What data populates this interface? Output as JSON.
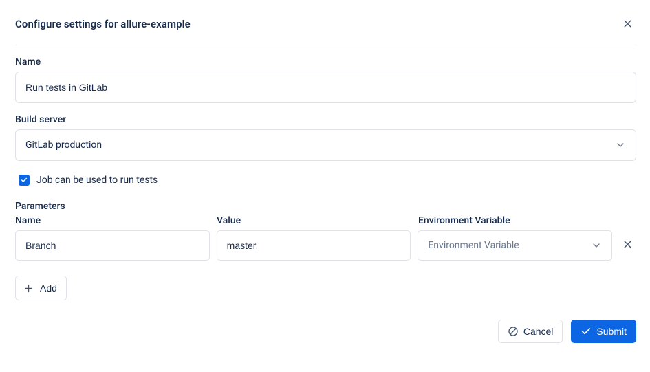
{
  "header": {
    "title": "Configure settings for allure-example"
  },
  "name": {
    "label": "Name",
    "value": "Run tests in GitLab"
  },
  "buildServer": {
    "label": "Build server",
    "value": "GitLab production"
  },
  "runTests": {
    "checked": true,
    "label": "Job can be used to run tests"
  },
  "parameters": {
    "sectionLabel": "Parameters",
    "columns": {
      "name": "Name",
      "value": "Value",
      "env": "Environment Variable"
    },
    "rows": [
      {
        "name": "Branch",
        "value": "master",
        "envPlaceholder": "Environment Variable"
      }
    ]
  },
  "buttons": {
    "add": "Add",
    "cancel": "Cancel",
    "submit": "Submit"
  }
}
